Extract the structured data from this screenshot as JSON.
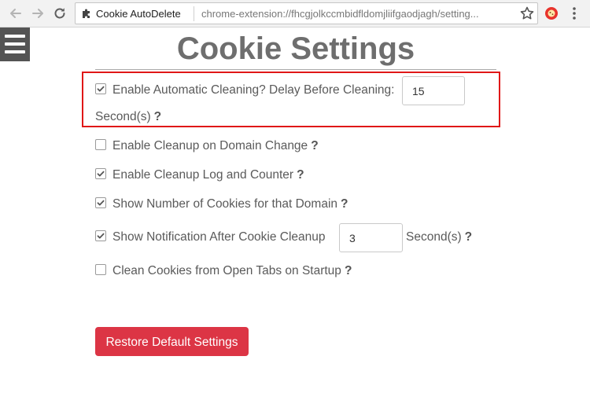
{
  "browser": {
    "tab_title": "Cookie AutoDelete",
    "url": "chrome-extension://fhcgjolkccmbidfldomjliifgaodjagh/setting...",
    "icons": [
      "back-arrow-icon",
      "forward-arrow-icon",
      "reload-icon",
      "puzzle-icon",
      "star-icon",
      "extension-icon",
      "menu-dots-icon"
    ]
  },
  "page": {
    "title": "Cookie Settings",
    "help_mark": "?"
  },
  "settings": [
    {
      "label": "Enable Automatic Cleaning? Delay Before Cleaning:",
      "checked": true,
      "input_value": "15",
      "suffix": "Second(s)"
    },
    {
      "label": "Enable Cleanup on Domain Change",
      "checked": false
    },
    {
      "label": "Enable Cleanup Log and Counter",
      "checked": true
    },
    {
      "label": "Show Number of Cookies for that Domain",
      "checked": true
    },
    {
      "label": "Show Notification After Cookie Cleanup",
      "checked": true,
      "input_value": "3",
      "suffix": "Second(s)"
    },
    {
      "label": "Clean Cookies from Open Tabs on Startup",
      "checked": false
    }
  ],
  "buttons": {
    "restore_defaults": "Restore Default Settings"
  },
  "colors": {
    "danger": "#dc3545",
    "highlight": "#e01818",
    "menu_bg": "#545454"
  }
}
